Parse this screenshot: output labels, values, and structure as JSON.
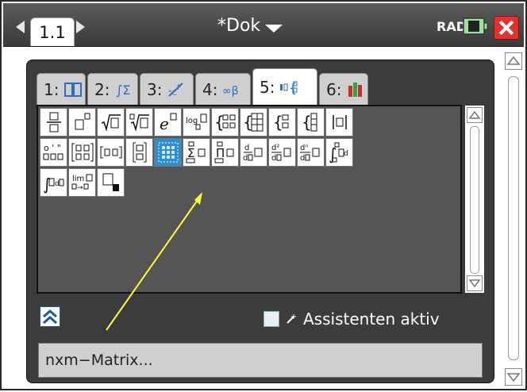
{
  "titlebar": {
    "page_tab": "1.1",
    "doc_title": "*Dok",
    "angle_mode": "RAD",
    "colors": {
      "bar": "#4a4a4a",
      "close": "#e53030"
    }
  },
  "catalog": {
    "tabs": [
      {
        "label": "1:",
        "icon": "catalog-book-icon"
      },
      {
        "label": "2:",
        "icon": "integral-sum-icon"
      },
      {
        "label": "3:",
        "icon": "unit-conversion-icon"
      },
      {
        "label": "4:",
        "icon": "infinity-beta-icon"
      },
      {
        "label": "5:",
        "icon": "math-templates-icon",
        "active": true
      },
      {
        "label": "6:",
        "icon": "libraries-icon"
      }
    ],
    "templates": [
      "fraction-template-icon",
      "exponent-template-icon",
      "square-root-template-icon",
      "nth-root-template-icon",
      "e-exponent-template-icon",
      "log-template-icon",
      "piecewise-2-template-icon",
      "piecewise-n-template-icon",
      "system-2-template-icon",
      "system-n-template-icon",
      "absolute-value-template-icon",
      "dms-template-icon",
      "matrix-2x2-template-icon",
      "row-vector-template-icon",
      "column-vector-template-icon",
      "matrix-nxm-template-icon",
      "sum-template-icon",
      "product-template-icon",
      "derivative-template-icon",
      "second-derivative-template-icon",
      "nth-derivative-template-icon",
      "definite-integral-template-icon",
      "indefinite-integral-template-icon",
      "limit-template-icon",
      "subscript-template-icon"
    ],
    "selected_template": "matrix-nxm-template-icon",
    "assistant_label": "Assistenten aktiv",
    "status_text": "nxm−Matrix..."
  }
}
